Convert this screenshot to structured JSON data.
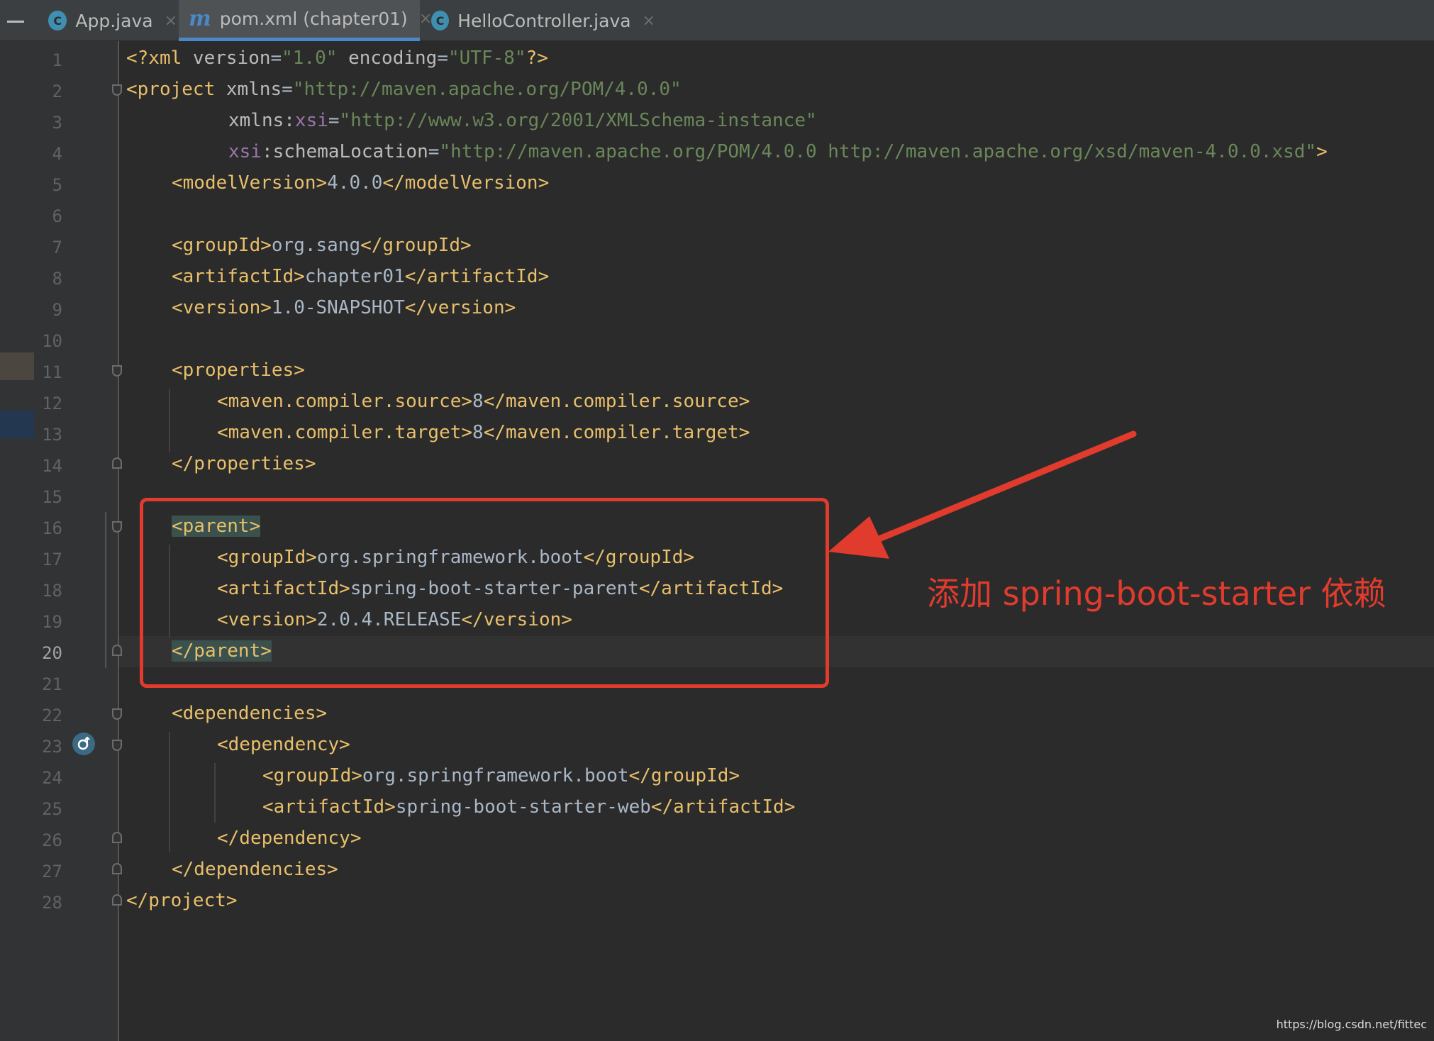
{
  "tabs": [
    {
      "label": "App.java",
      "icon": "java-class-run-icon"
    },
    {
      "label": "pom.xml (chapter01)",
      "icon": "maven-icon",
      "active": true
    },
    {
      "label": "HelloController.java",
      "icon": "java-class-icon"
    }
  ],
  "tab_icon_letters": {
    "app": "C",
    "maven": "m",
    "hello": "C"
  },
  "close_glyph": "×",
  "editor": {
    "current_line": 20,
    "line_numbers": [
      "1",
      "2",
      "3",
      "4",
      "5",
      "6",
      "7",
      "8",
      "9",
      "10",
      "11",
      "12",
      "13",
      "14",
      "15",
      "16",
      "17",
      "18",
      "19",
      "20",
      "21",
      "22",
      "23",
      "24",
      "25",
      "26",
      "27",
      "28"
    ],
    "code": {
      "l1": {
        "a": "<?xml ",
        "b": "version",
        "c": "=",
        "d": "\"1.0\"",
        "e": " encoding",
        "f": "=",
        "g": "\"UTF-8\"",
        "h": "?>"
      },
      "l2": {
        "a": "<project ",
        "b": "xmlns",
        "c": "=",
        "d": "\"http://maven.apache.org/POM/4.0.0\""
      },
      "l3": {
        "a": "xmlns:",
        "b": "xsi",
        "c": "=",
        "d": "\"http://www.w3.org/2001/XMLSchema-instance\""
      },
      "l4": {
        "a": "xsi",
        "b": ":schemaLocation",
        "c": "=",
        "d": "\"http://maven.apache.org/POM/4.0.0 http://maven.apache.org/xsd/maven-4.0.0.xsd\"",
        "e": ">"
      },
      "l5": {
        "a": "<modelVersion>",
        "b": "4.0.0",
        "c": "</modelVersion>"
      },
      "l7": {
        "a": "<groupId>",
        "b": "org.sang",
        "c": "</groupId>"
      },
      "l8": {
        "a": "<artifactId>",
        "b": "chapter01",
        "c": "</artifactId>"
      },
      "l9": {
        "a": "<version>",
        "b": "1.0-SNAPSHOT",
        "c": "</version>"
      },
      "l11": {
        "a": "<properties>"
      },
      "l12": {
        "a": "<maven.compiler.source>",
        "b": "8",
        "c": "</maven.compiler.source>"
      },
      "l13": {
        "a": "<maven.compiler.target>",
        "b": "8",
        "c": "</maven.compiler.target>"
      },
      "l14": {
        "a": "</properties>"
      },
      "l16": {
        "a": "<parent>"
      },
      "l17": {
        "a": "<groupId>",
        "b": "org.springframework.boot",
        "c": "</groupId>"
      },
      "l18": {
        "a": "<artifactId>",
        "b": "spring-boot-starter-parent",
        "c": "</artifactId>"
      },
      "l19": {
        "a": "<version>",
        "b": "2.0.4.RELEASE",
        "c": "</version>"
      },
      "l20": {
        "a": "</parent>"
      },
      "l22": {
        "a": "<dependencies>"
      },
      "l23": {
        "a": "<dependency>"
      },
      "l24": {
        "a": "<groupId>",
        "b": "org.springframework.boot",
        "c": "</groupId>"
      },
      "l25": {
        "a": "<artifactId>",
        "b": "spring-boot-starter-web",
        "c": "</artifactId>"
      },
      "l26": {
        "a": "</dependency>"
      },
      "l27": {
        "a": "</dependencies>"
      },
      "l28": {
        "a": "</project>"
      }
    }
  },
  "annotation": {
    "text": "添加 spring-boot-starter 依赖",
    "color": "#e03b2d"
  },
  "watermark": "https://blog.csdn.net/fittec",
  "colors": {
    "background": "#2b2b2b",
    "tag": "#e8bf6a",
    "string": "#6a8759",
    "namespace": "#9876aa",
    "text": "#a9b7c6"
  }
}
